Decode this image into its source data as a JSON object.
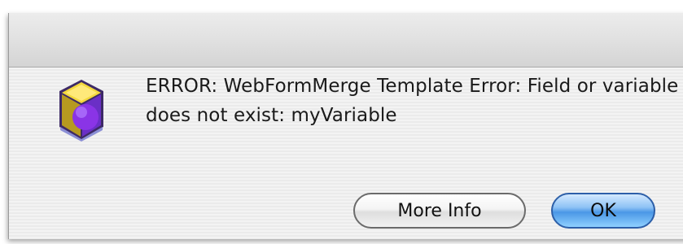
{
  "dialog": {
    "message": "ERROR: WebFormMerge Template Error: Field or variable does not exist: myVariable",
    "icon": "app-cube-icon",
    "buttons": {
      "more_info_label": "More Info",
      "ok_label": "OK"
    }
  },
  "colors": {
    "ok_button": "#4a97e6",
    "icon_face": "#7b2fd6",
    "icon_top": "#f2d53a"
  }
}
